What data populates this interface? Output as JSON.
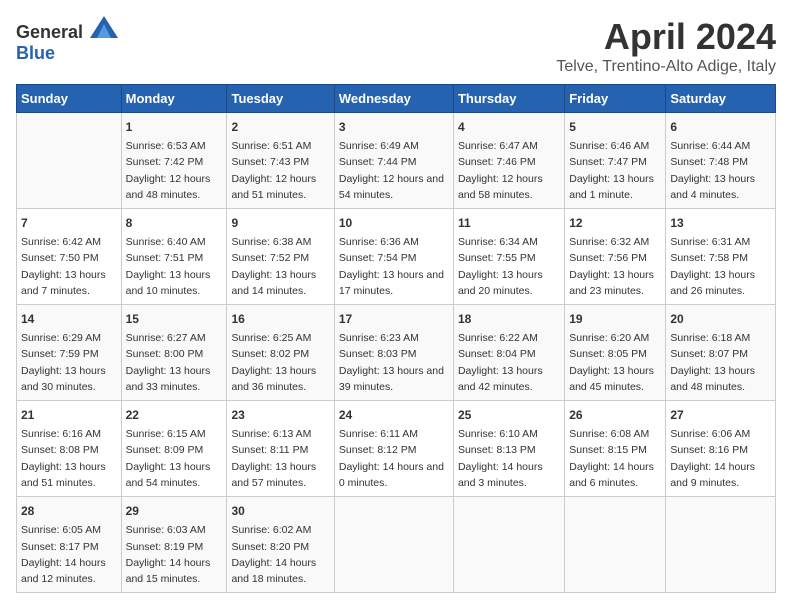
{
  "logo": {
    "text_general": "General",
    "text_blue": "Blue"
  },
  "header": {
    "title": "April 2024",
    "subtitle": "Telve, Trentino-Alto Adige, Italy"
  },
  "weekdays": [
    "Sunday",
    "Monday",
    "Tuesday",
    "Wednesday",
    "Thursday",
    "Friday",
    "Saturday"
  ],
  "weeks": [
    [
      {
        "day": "",
        "sunrise": "",
        "sunset": "",
        "daylight": ""
      },
      {
        "day": "1",
        "sunrise": "Sunrise: 6:53 AM",
        "sunset": "Sunset: 7:42 PM",
        "daylight": "Daylight: 12 hours and 48 minutes."
      },
      {
        "day": "2",
        "sunrise": "Sunrise: 6:51 AM",
        "sunset": "Sunset: 7:43 PM",
        "daylight": "Daylight: 12 hours and 51 minutes."
      },
      {
        "day": "3",
        "sunrise": "Sunrise: 6:49 AM",
        "sunset": "Sunset: 7:44 PM",
        "daylight": "Daylight: 12 hours and 54 minutes."
      },
      {
        "day": "4",
        "sunrise": "Sunrise: 6:47 AM",
        "sunset": "Sunset: 7:46 PM",
        "daylight": "Daylight: 12 hours and 58 minutes."
      },
      {
        "day": "5",
        "sunrise": "Sunrise: 6:46 AM",
        "sunset": "Sunset: 7:47 PM",
        "daylight": "Daylight: 13 hours and 1 minute."
      },
      {
        "day": "6",
        "sunrise": "Sunrise: 6:44 AM",
        "sunset": "Sunset: 7:48 PM",
        "daylight": "Daylight: 13 hours and 4 minutes."
      }
    ],
    [
      {
        "day": "7",
        "sunrise": "Sunrise: 6:42 AM",
        "sunset": "Sunset: 7:50 PM",
        "daylight": "Daylight: 13 hours and 7 minutes."
      },
      {
        "day": "8",
        "sunrise": "Sunrise: 6:40 AM",
        "sunset": "Sunset: 7:51 PM",
        "daylight": "Daylight: 13 hours and 10 minutes."
      },
      {
        "day": "9",
        "sunrise": "Sunrise: 6:38 AM",
        "sunset": "Sunset: 7:52 PM",
        "daylight": "Daylight: 13 hours and 14 minutes."
      },
      {
        "day": "10",
        "sunrise": "Sunrise: 6:36 AM",
        "sunset": "Sunset: 7:54 PM",
        "daylight": "Daylight: 13 hours and 17 minutes."
      },
      {
        "day": "11",
        "sunrise": "Sunrise: 6:34 AM",
        "sunset": "Sunset: 7:55 PM",
        "daylight": "Daylight: 13 hours and 20 minutes."
      },
      {
        "day": "12",
        "sunrise": "Sunrise: 6:32 AM",
        "sunset": "Sunset: 7:56 PM",
        "daylight": "Daylight: 13 hours and 23 minutes."
      },
      {
        "day": "13",
        "sunrise": "Sunrise: 6:31 AM",
        "sunset": "Sunset: 7:58 PM",
        "daylight": "Daylight: 13 hours and 26 minutes."
      }
    ],
    [
      {
        "day": "14",
        "sunrise": "Sunrise: 6:29 AM",
        "sunset": "Sunset: 7:59 PM",
        "daylight": "Daylight: 13 hours and 30 minutes."
      },
      {
        "day": "15",
        "sunrise": "Sunrise: 6:27 AM",
        "sunset": "Sunset: 8:00 PM",
        "daylight": "Daylight: 13 hours and 33 minutes."
      },
      {
        "day": "16",
        "sunrise": "Sunrise: 6:25 AM",
        "sunset": "Sunset: 8:02 PM",
        "daylight": "Daylight: 13 hours and 36 minutes."
      },
      {
        "day": "17",
        "sunrise": "Sunrise: 6:23 AM",
        "sunset": "Sunset: 8:03 PM",
        "daylight": "Daylight: 13 hours and 39 minutes."
      },
      {
        "day": "18",
        "sunrise": "Sunrise: 6:22 AM",
        "sunset": "Sunset: 8:04 PM",
        "daylight": "Daylight: 13 hours and 42 minutes."
      },
      {
        "day": "19",
        "sunrise": "Sunrise: 6:20 AM",
        "sunset": "Sunset: 8:05 PM",
        "daylight": "Daylight: 13 hours and 45 minutes."
      },
      {
        "day": "20",
        "sunrise": "Sunrise: 6:18 AM",
        "sunset": "Sunset: 8:07 PM",
        "daylight": "Daylight: 13 hours and 48 minutes."
      }
    ],
    [
      {
        "day": "21",
        "sunrise": "Sunrise: 6:16 AM",
        "sunset": "Sunset: 8:08 PM",
        "daylight": "Daylight: 13 hours and 51 minutes."
      },
      {
        "day": "22",
        "sunrise": "Sunrise: 6:15 AM",
        "sunset": "Sunset: 8:09 PM",
        "daylight": "Daylight: 13 hours and 54 minutes."
      },
      {
        "day": "23",
        "sunrise": "Sunrise: 6:13 AM",
        "sunset": "Sunset: 8:11 PM",
        "daylight": "Daylight: 13 hours and 57 minutes."
      },
      {
        "day": "24",
        "sunrise": "Sunrise: 6:11 AM",
        "sunset": "Sunset: 8:12 PM",
        "daylight": "Daylight: 14 hours and 0 minutes."
      },
      {
        "day": "25",
        "sunrise": "Sunrise: 6:10 AM",
        "sunset": "Sunset: 8:13 PM",
        "daylight": "Daylight: 14 hours and 3 minutes."
      },
      {
        "day": "26",
        "sunrise": "Sunrise: 6:08 AM",
        "sunset": "Sunset: 8:15 PM",
        "daylight": "Daylight: 14 hours and 6 minutes."
      },
      {
        "day": "27",
        "sunrise": "Sunrise: 6:06 AM",
        "sunset": "Sunset: 8:16 PM",
        "daylight": "Daylight: 14 hours and 9 minutes."
      }
    ],
    [
      {
        "day": "28",
        "sunrise": "Sunrise: 6:05 AM",
        "sunset": "Sunset: 8:17 PM",
        "daylight": "Daylight: 14 hours and 12 minutes."
      },
      {
        "day": "29",
        "sunrise": "Sunrise: 6:03 AM",
        "sunset": "Sunset: 8:19 PM",
        "daylight": "Daylight: 14 hours and 15 minutes."
      },
      {
        "day": "30",
        "sunrise": "Sunrise: 6:02 AM",
        "sunset": "Sunset: 8:20 PM",
        "daylight": "Daylight: 14 hours and 18 minutes."
      },
      {
        "day": "",
        "sunrise": "",
        "sunset": "",
        "daylight": ""
      },
      {
        "day": "",
        "sunrise": "",
        "sunset": "",
        "daylight": ""
      },
      {
        "day": "",
        "sunrise": "",
        "sunset": "",
        "daylight": ""
      },
      {
        "day": "",
        "sunrise": "",
        "sunset": "",
        "daylight": ""
      }
    ]
  ]
}
